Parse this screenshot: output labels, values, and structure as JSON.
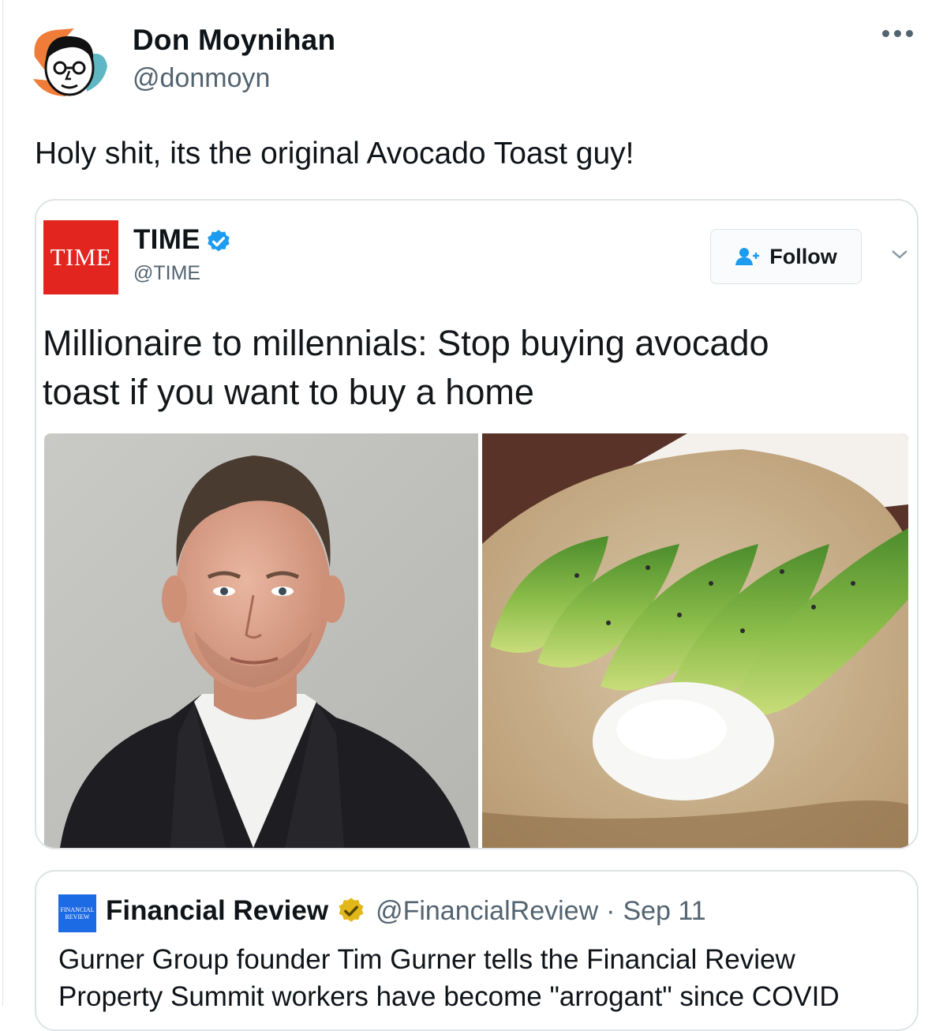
{
  "tweet": {
    "author_name": "Don Moynihan",
    "author_handle": "@donmoyn",
    "text": "Holy shit, its the original Avocado Toast guy!",
    "more_icon": "more-horizontal-icon"
  },
  "embedded_post": {
    "logo_text": "TIME",
    "account_name": "TIME",
    "account_handle": "@TIME",
    "follow_label": "Follow",
    "verified_color": "#1d9bf0",
    "logo_color": "#e2251f",
    "headline_line1": "Millionaire to millennials: Stop buying avocado",
    "headline_line2": "toast if you want to buy a home",
    "images": [
      "man-in-suit-portrait",
      "avocado-toast-with-egg"
    ]
  },
  "quoted_tweet": {
    "logo_line1": "FINANCIAL",
    "logo_line2": "REVIEW",
    "account_name": "Financial Review",
    "account_handle": "@FinancialReview",
    "separator": "·",
    "date": "Sep 11",
    "badge_color": "#e2b719",
    "text_line1": "Gurner Group founder Tim Gurner tells the Financial Review",
    "text_line2": "Property Summit workers have become \"arrogant\" since COVID"
  }
}
